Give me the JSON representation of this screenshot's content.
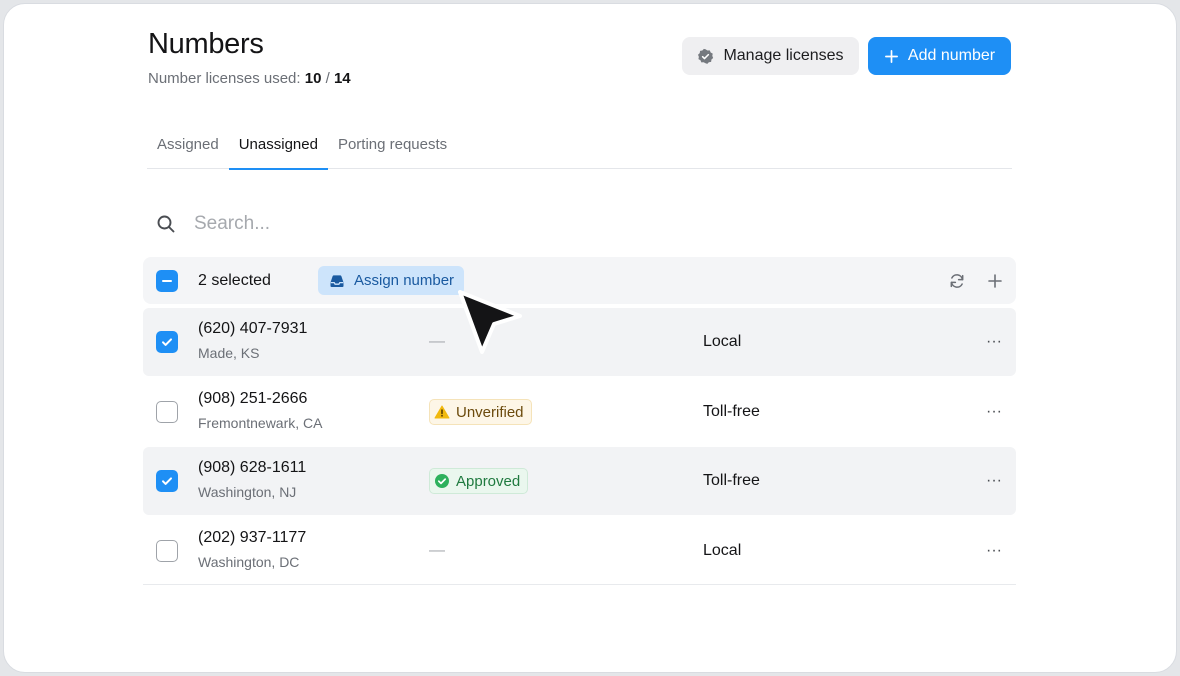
{
  "header": {
    "title": "Numbers",
    "license_label": "Number licenses used:",
    "license_used": "10",
    "license_sep": "/",
    "license_total": "14",
    "manage_label": "Manage licenses",
    "add_label": "Add number"
  },
  "tabs": [
    {
      "label": "Assigned",
      "active": false
    },
    {
      "label": "Unassigned",
      "active": true
    },
    {
      "label": "Porting requests",
      "active": false
    }
  ],
  "search": {
    "placeholder": "Search..."
  },
  "selection": {
    "count_label": "2 selected",
    "assign_label": "Assign number"
  },
  "rows": [
    {
      "number": "(620) 407-7931",
      "location": "Made, KS",
      "status": "—",
      "type": "Local",
      "selected": true
    },
    {
      "number": "(908) 251-2666",
      "location": "Fremontnewark, CA",
      "status": "Unverified",
      "type": "Toll-free",
      "selected": false
    },
    {
      "number": "(908) 628-1611",
      "location": "Washington, NJ",
      "status": "Approved",
      "type": "Toll-free",
      "selected": true
    },
    {
      "number": "(202) 937-1177",
      "location": "Washington, DC",
      "status": "—",
      "type": "Local",
      "selected": false
    }
  ],
  "row_menu": "···",
  "colors": {
    "accent": "#1e8ff5",
    "assign_bg": "#cde4fb",
    "warning": "#f1b90f",
    "success": "#2eb15d"
  },
  "icons": [
    "settings-badge-icon",
    "plus-icon",
    "search-icon",
    "inbox-icon",
    "refresh-icon",
    "add-icon",
    "check-icon",
    "minus-icon",
    "warning-icon",
    "check-circle-icon",
    "more-icon",
    "cursor-arrow"
  ]
}
